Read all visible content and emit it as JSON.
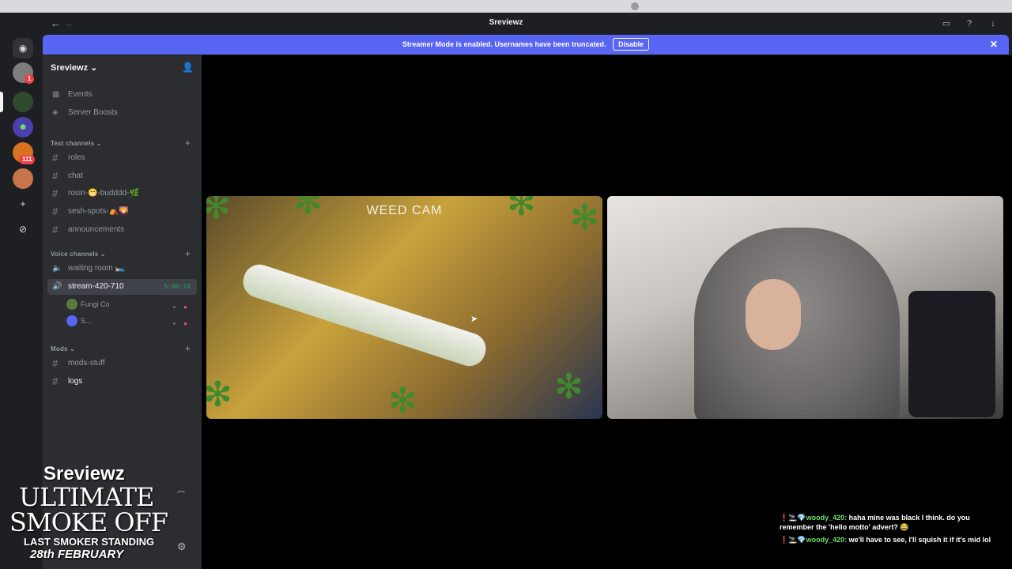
{
  "window": {
    "title": "Sreviewz",
    "back": "←",
    "forward": "→"
  },
  "banner": {
    "message": "Streamer Mode is enabled. Usernames have been truncated.",
    "action": "Disable",
    "close": "✕"
  },
  "server_rail": {
    "badges": [
      "1",
      "111"
    ]
  },
  "guild": {
    "name": "Sreviewz ⌄"
  },
  "shortcuts": [
    {
      "label": "Events"
    },
    {
      "label": "Server Boosts"
    }
  ],
  "categories": {
    "text": "Text channels ⌄",
    "voice": "Voice channels ⌄",
    "mods": "Mods ⌄"
  },
  "text_channels": [
    "roles",
    "chat",
    "rosin-😁-budddd-🌿",
    "sesh-spots-⛺🌄",
    "announcements"
  ],
  "voice_channels": [
    {
      "label": "waiting room 🛌"
    },
    {
      "label": "stream-420-710",
      "timer": "5:00:24"
    }
  ],
  "voice_users": [
    "Fungi Co",
    "S..."
  ],
  "mod_channels": [
    "mods-stuff",
    "logs"
  ],
  "stream": {
    "overlay": "WEED CAM"
  },
  "promo": {
    "line1": "Sreviewz",
    "line2": "ULTIMATE",
    "line3": "SMOKE OFF",
    "line4": "LAST SMOKER STANDING",
    "line5": "28th FEBRUARY"
  },
  "chat": [
    {
      "prefix": "❗🚬💎",
      "user": "woody_420:",
      "text": " haha mine was black I think. do you remember the 'hello motto' advert? 😂"
    },
    {
      "prefix": "❗🚬💎",
      "user": "woody_420:",
      "text": " we'll have to see, I'll squish it if it's mid lol"
    }
  ],
  "colors": {
    "accent": "#5865f2",
    "background": "#1e1f22",
    "sidebar": "#2b2d31",
    "live_green": "#23a55a"
  },
  "icons": [
    "apple-icon",
    "discord-home-icon",
    "add-server-icon",
    "explore-icon",
    "invite-icon",
    "calendar-icon",
    "boost-icon",
    "hash-icon",
    "speaker-icon",
    "camera-icon",
    "settings-icon",
    "disconnect-icon"
  ]
}
